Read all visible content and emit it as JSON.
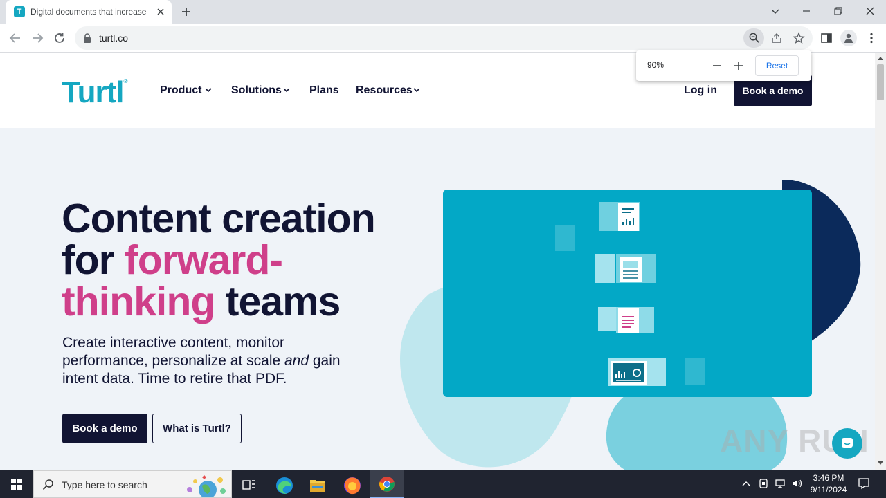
{
  "browser": {
    "tab_title": "Digital documents that increase",
    "tab_favicon_letter": "T",
    "url": "turtl.co",
    "zoom": {
      "level": "90%",
      "reset_label": "Reset"
    }
  },
  "site": {
    "logo_text": "Turtl",
    "logo_mark": "®",
    "nav": {
      "items": [
        {
          "label": "Product",
          "dropdown": true
        },
        {
          "label": "Solutions",
          "dropdown": true
        },
        {
          "label": "Plans",
          "dropdown": false
        },
        {
          "label": "Resources",
          "dropdown": true
        }
      ],
      "login_label": "Log in",
      "cta_label": "Book a demo"
    },
    "hero": {
      "headline_1": "Content creation",
      "headline_2a": "for ",
      "headline_2b": "forward-",
      "headline_3a": "thinking",
      "headline_3b": " teams",
      "sub_1": "Create interactive content, monitor performance, personalize at scale ",
      "sub_em": "and",
      "sub_2": " gain intent data. Time to retire that PDF.",
      "primary_button": "Book a demo",
      "secondary_button": "What is Turtl?"
    },
    "colors": {
      "brand_teal": "#15a7c1",
      "navy": "#111433",
      "pink": "#cf3f8a"
    }
  },
  "watermark": "ANY RUN",
  "taskbar": {
    "search_placeholder": "Type here to search",
    "time": "3:46 PM",
    "date": "9/11/2024"
  }
}
